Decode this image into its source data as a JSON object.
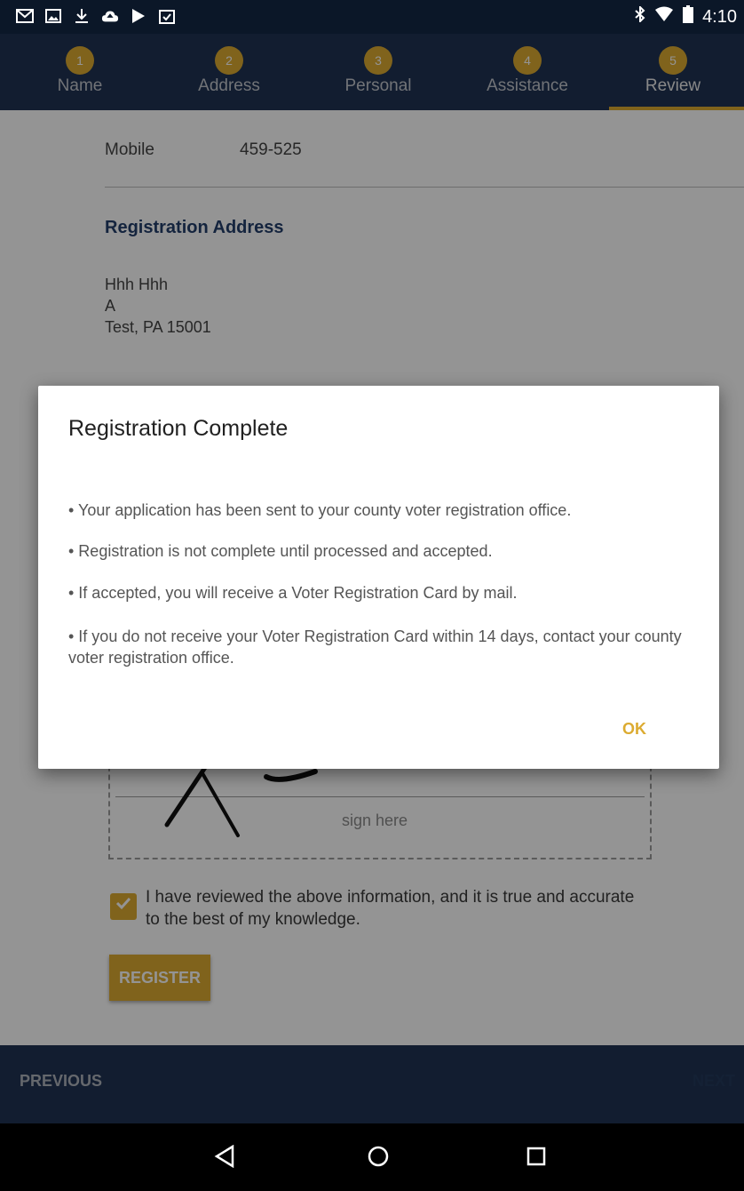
{
  "status_bar": {
    "icons": [
      "gmail-icon",
      "gallery-icon",
      "download-icon",
      "cloud-upload-icon",
      "play-store-icon",
      "clipboard-check-icon"
    ],
    "right_icons": [
      "bluetooth-icon",
      "wifi-icon",
      "battery-icon"
    ],
    "time": "4:10"
  },
  "stepper": {
    "steps": [
      {
        "number": "1",
        "label": "Name"
      },
      {
        "number": "2",
        "label": "Address"
      },
      {
        "number": "3",
        "label": "Personal"
      },
      {
        "number": "4",
        "label": "Assistance"
      },
      {
        "number": "5",
        "label": "Review"
      }
    ],
    "active_step": "5",
    "accent_color": "#dcab31",
    "bar_color": "#1f3353"
  },
  "review": {
    "mobile_label": "Mobile",
    "mobile_value": "459-525",
    "registration_address_title": "Registration Address",
    "address_lines": [
      "Hhh Hhh",
      "A",
      "Test, PA 15001"
    ],
    "sign_here": "sign here",
    "confirm_text": "I have reviewed the above information, and it is true and accurate to the best of my knowledge.",
    "confirm_checked": true,
    "register_button": "REGISTER"
  },
  "bottom_nav": {
    "previous": "PREVIOUS",
    "next": "NEXT"
  },
  "dialog": {
    "title": "Registration Complete",
    "bullets": [
      "• Your application has been sent to your county voter registration office.",
      "• Registration is not complete until processed and accepted.",
      "• If accepted, you will receive a Voter Registration Card by mail.",
      "• If you do not receive your Voter Registration Card within 14 days, contact your county voter registration office."
    ],
    "ok_button": "OK"
  },
  "system_nav": {
    "buttons": [
      "back-icon",
      "home-icon",
      "recents-icon"
    ]
  }
}
